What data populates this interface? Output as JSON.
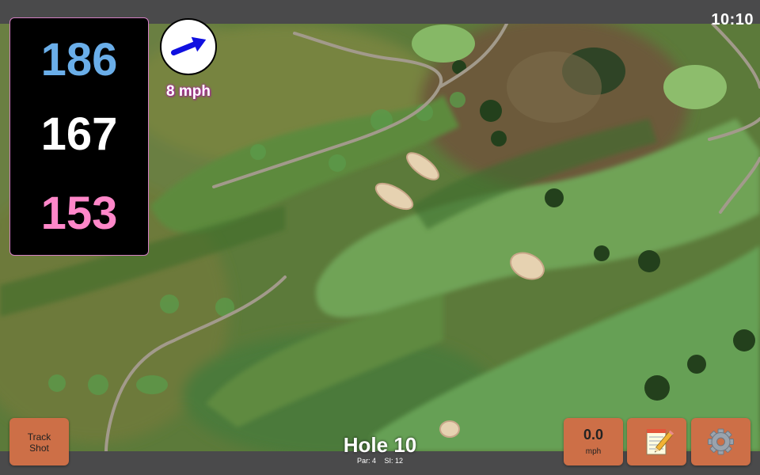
{
  "status": {
    "time": "10:10"
  },
  "distances": {
    "back": "186",
    "middle": "167",
    "front": "153"
  },
  "wind": {
    "speed": "8 mph",
    "direction_icon": "arrow-icon",
    "direction": "up-right"
  },
  "buttons": {
    "track_shot": "Track\nShot",
    "speed_value": "0.0",
    "speed_unit": "mph",
    "notes_icon": "notepad-icon",
    "settings_icon": "gear-icon"
  },
  "hole": {
    "title": "Hole 10",
    "par": "Par: 4",
    "si": "SI: 12"
  },
  "colors": {
    "back": "#6aaee9",
    "middle": "#ffffff",
    "front": "#ff87c9",
    "button": "#cd6f47",
    "wind_arrow": "#1010e0",
    "wind_text_glow": "#b12aa5"
  }
}
